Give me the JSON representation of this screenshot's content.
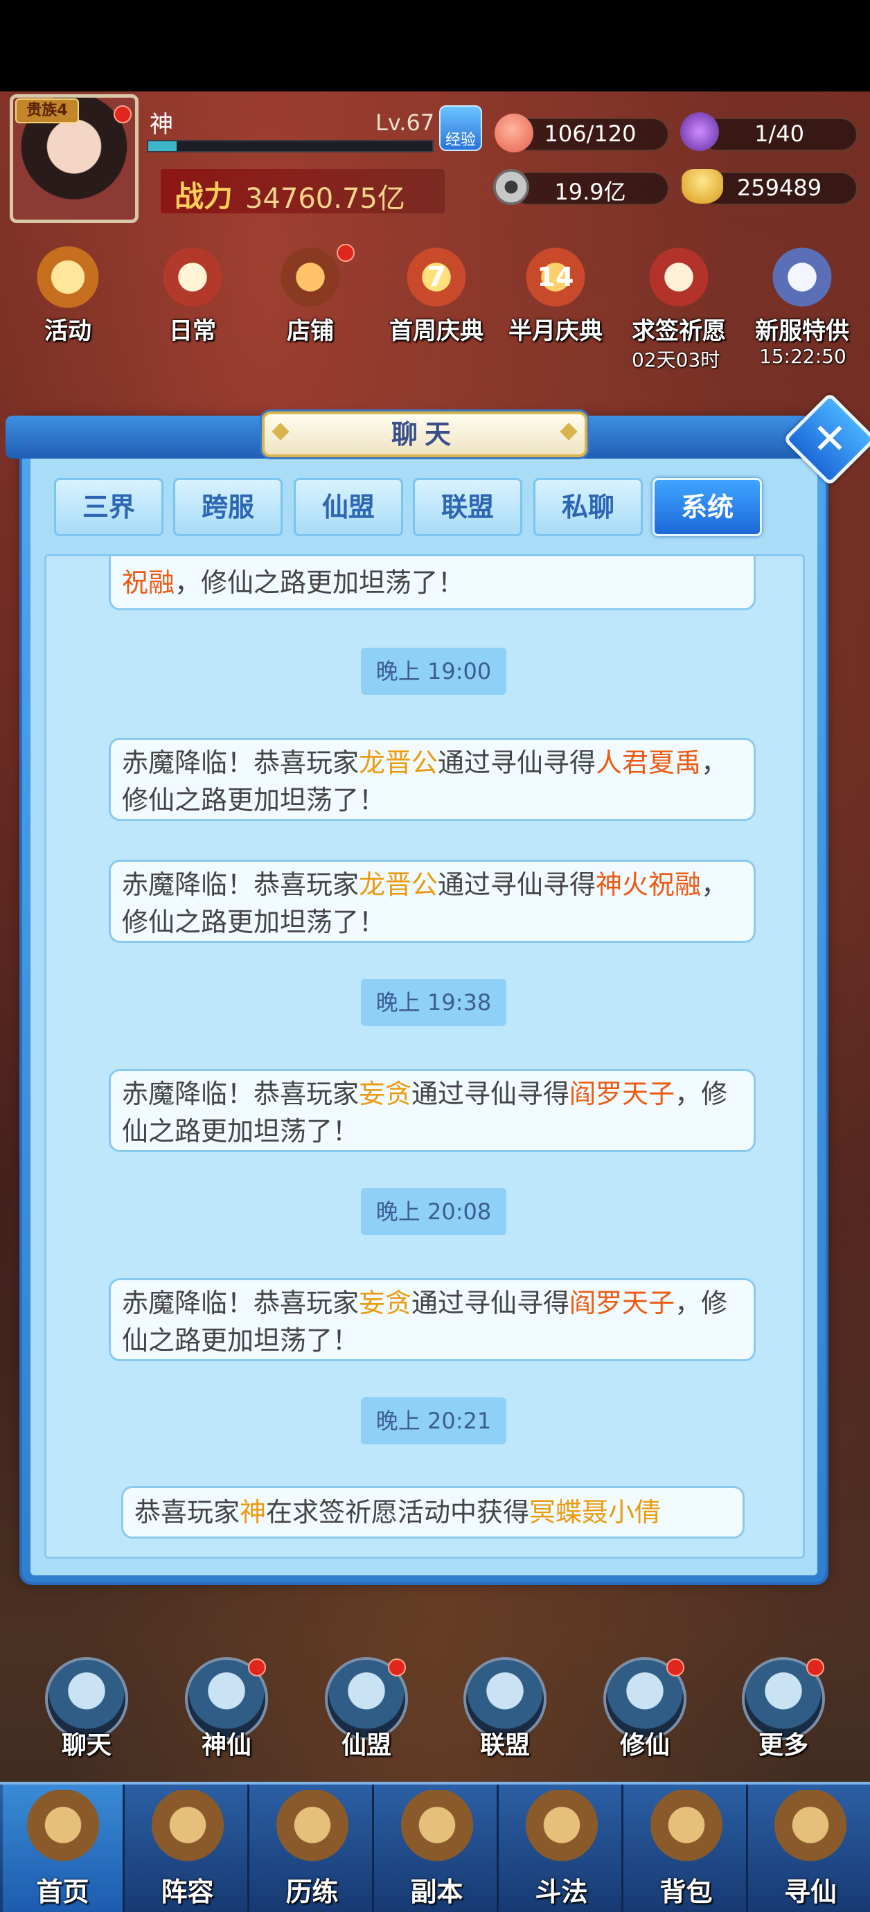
{
  "player": {
    "vip": "贵族4",
    "name": "神",
    "level": "Lv.67",
    "exp_button": "经验",
    "exp_progress": 0.1,
    "power_label": "战力",
    "power_value": "34760.75亿"
  },
  "resources": {
    "stamina": "106/120",
    "energy": "1/40",
    "coins": "19.9亿",
    "gold": "259489"
  },
  "activities": [
    {
      "label": "活动"
    },
    {
      "label": "日常"
    },
    {
      "label": "店铺"
    },
    {
      "label": "首周庆典",
      "badge": "7"
    },
    {
      "label": "半月庆典",
      "badge": "14"
    },
    {
      "label": "求签祈愿",
      "sub": "02天03时"
    },
    {
      "label": "新服特供",
      "sub": "15:22:50"
    }
  ],
  "chat": {
    "title": "聊天",
    "close_label": "✕",
    "tabs": [
      "三界",
      "跨服",
      "仙盟",
      "联盟",
      "私聊",
      "系统"
    ],
    "active_tab": "系统",
    "messages": [
      {
        "type": "bubble",
        "parts": [
          [
            "r",
            "祝融"
          ],
          [
            "n",
            "，修仙之路更加坦荡了！"
          ]
        ]
      },
      {
        "type": "time",
        "text": "晚上 19:00"
      },
      {
        "type": "bubble",
        "parts": [
          [
            "n",
            "赤魔降临！恭喜玩家"
          ],
          [
            "o",
            "龙晋公"
          ],
          [
            "n",
            "通过寻仙寻得"
          ],
          [
            "r",
            "人君夏禹"
          ],
          [
            "n",
            "，修仙之路更加坦荡了！"
          ]
        ]
      },
      {
        "type": "bubble",
        "parts": [
          [
            "n",
            "赤魔降临！恭喜玩家"
          ],
          [
            "o",
            "龙晋公"
          ],
          [
            "n",
            "通过寻仙寻得"
          ],
          [
            "r",
            "神火祝融"
          ],
          [
            "n",
            "，修仙之路更加坦荡了！"
          ]
        ]
      },
      {
        "type": "time",
        "text": "晚上 19:38"
      },
      {
        "type": "bubble",
        "parts": [
          [
            "n",
            "赤魔降临！恭喜玩家"
          ],
          [
            "o",
            "妄贪"
          ],
          [
            "n",
            "通过寻仙寻得"
          ],
          [
            "r",
            "阎罗天子"
          ],
          [
            "n",
            "，修仙之路更加坦荡了！"
          ]
        ]
      },
      {
        "type": "time",
        "text": "晚上 20:08"
      },
      {
        "type": "bubble",
        "parts": [
          [
            "n",
            "赤魔降临！恭喜玩家"
          ],
          [
            "o",
            "妄贪"
          ],
          [
            "n",
            "通过寻仙寻得"
          ],
          [
            "r",
            "阎罗天子"
          ],
          [
            "n",
            "，修仙之路更加坦荡了！"
          ]
        ]
      },
      {
        "type": "time",
        "text": "晚上 20:21"
      },
      {
        "type": "bubble",
        "parts": [
          [
            "n",
            "恭喜玩家"
          ],
          [
            "o",
            "神"
          ],
          [
            "n",
            "在求签祈愿活动中获得"
          ],
          [
            "o",
            "冥蝶聂小倩"
          ]
        ]
      }
    ]
  },
  "bottom_menu": [
    "聊天",
    "神仙",
    "仙盟",
    "联盟",
    "修仙",
    "更多"
  ],
  "nav": {
    "items": [
      "首页",
      "阵容",
      "历练",
      "副本",
      "斗法",
      "背包",
      "寻仙"
    ],
    "active": "首页"
  },
  "colors": {
    "highlight_orange": "#ec9b10",
    "highlight_red": "#ee5a12",
    "tab_active": "#1d69d8"
  }
}
